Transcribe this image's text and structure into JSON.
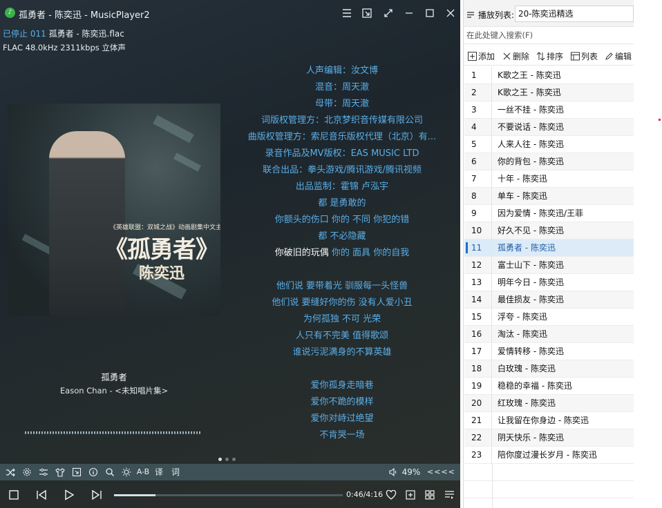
{
  "window": {
    "title": "孤勇者 - 陈奕迅 - MusicPlayer2",
    "app_icon": "music-note-icon"
  },
  "track_info": {
    "status": "已停止",
    "index": "011",
    "file": "孤勇者 - 陈奕迅.flac",
    "format": "FLAC 48.0kHz 2311kbps 立体声"
  },
  "cover": {
    "small_text": "《英雄联盟：双城之战》动画剧集中文主题曲",
    "title": "《孤勇者》",
    "artist": "陈奕迅"
  },
  "now_playing": {
    "title": "孤勇者",
    "artist_album": "Eason Chan - <未知唱片集>"
  },
  "lyrics": [
    {
      "text": "人声编辑：汝文博"
    },
    {
      "text": "混音：周天澈"
    },
    {
      "text": "母带：周天澈"
    },
    {
      "text": "词版权管理方：北京梦织音传媒有限公司"
    },
    {
      "text": "曲版权管理方：索尼音乐版权代理（北京）有..."
    },
    {
      "text": "录音作品及MV版权：EAS MUSIC LTD"
    },
    {
      "text": "联合出品：拳头游戏/腾讯游戏/腾讯视频"
    },
    {
      "text": "出品监制：霍锦 卢泓宇"
    },
    {
      "text": "都 是勇敢的"
    },
    {
      "text": "你额头的伤口 你的 不同 你犯的错"
    },
    {
      "text": "都 不必隐藏"
    },
    {
      "sung": "你破旧的玩偶",
      "text": " 你的 面具 你的自我"
    },
    {
      "text": ""
    },
    {
      "text": "他们说 要带着光 驯服每一头怪兽"
    },
    {
      "text": "他们说 要缝好你的伤 没有人爱小丑"
    },
    {
      "text": "为何孤独 不可 光荣"
    },
    {
      "text": "人只有不完美 值得歌颂"
    },
    {
      "text": "谁说污泥满身的不算英雄"
    },
    {
      "text": ""
    },
    {
      "text": "爱你孤身走暗巷"
    },
    {
      "text": "爱你不跪的模样"
    },
    {
      "text": "爱你对峙过绝望"
    },
    {
      "text": "不肯哭一场"
    }
  ],
  "toolbar": {
    "ab_label": "A-B",
    "translate_label": "译",
    "lyrics_label": "词",
    "volume": "49%",
    "more_label": "<<<<"
  },
  "playback": {
    "time": "0:46/4:16",
    "progress": 0.18
  },
  "playlist": {
    "label": "播放列表:",
    "selected": "20-陈奕迅精选",
    "search_placeholder": "在此处键入搜索(F)",
    "tools": {
      "add": "添加",
      "delete": "删除",
      "sort": "排序",
      "list": "列表",
      "edit": "编辑"
    },
    "current_index": 11,
    "items": [
      {
        "num": "1",
        "name": "K歌之王 - 陈奕迅"
      },
      {
        "num": "2",
        "name": "K歌之王 - 陈奕迅"
      },
      {
        "num": "3",
        "name": "一丝不挂 - 陈奕迅"
      },
      {
        "num": "4",
        "name": "不要说话 - 陈奕迅"
      },
      {
        "num": "5",
        "name": "人来人往 - 陈奕迅"
      },
      {
        "num": "6",
        "name": "你的背包 - 陈奕迅"
      },
      {
        "num": "7",
        "name": "十年 - 陈奕迅"
      },
      {
        "num": "8",
        "name": "单车 - 陈奕迅"
      },
      {
        "num": "9",
        "name": "因为爱情 - 陈奕迅/王菲"
      },
      {
        "num": "10",
        "name": "好久不见 - 陈奕迅"
      },
      {
        "num": "11",
        "name": "孤勇者 - 陈奕迅"
      },
      {
        "num": "12",
        "name": "富士山下 - 陈奕迅"
      },
      {
        "num": "13",
        "name": "明年今日 - 陈奕迅"
      },
      {
        "num": "14",
        "name": "最佳损友 - 陈奕迅"
      },
      {
        "num": "15",
        "name": "浮夸 - 陈奕迅"
      },
      {
        "num": "16",
        "name": "淘汰 - 陈奕迅"
      },
      {
        "num": "17",
        "name": "爱情转移 - 陈奕迅"
      },
      {
        "num": "18",
        "name": "白玫瑰 - 陈奕迅"
      },
      {
        "num": "19",
        "name": "稳稳的幸福 - 陈奕迅"
      },
      {
        "num": "20",
        "name": "红玫瑰 - 陈奕迅"
      },
      {
        "num": "21",
        "name": "让我留在你身边 - 陈奕迅"
      },
      {
        "num": "22",
        "name": "阴天快乐 - 陈奕迅"
      },
      {
        "num": "23",
        "name": "陪你度过漫长岁月 - 陈奕迅"
      }
    ]
  },
  "colors": {
    "lyric_accent": "#5aaee8",
    "current_row_bg": "#dcebf7"
  }
}
